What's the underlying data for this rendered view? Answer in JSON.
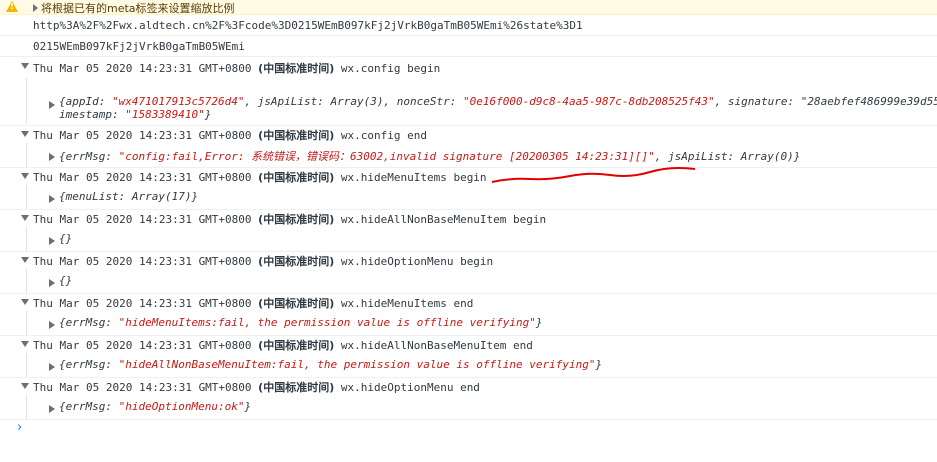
{
  "warning": {
    "text": "将根据已有的meta标签来设置缩放比例",
    "icon": "warning-triangle-icon"
  },
  "url_lines": [
    "http%3A%2F%2Fwx.aldtech.cn%2F%3Fcode%3D0215WEmB097kFj2jVrkB0gaTmB05WEmi%26state%3D1",
    "0215WEmB097kFj2jVrkB0gaTmB05WEmi"
  ],
  "log_groups": [
    {
      "date": "Thu Mar 05 2020 14:23:31 GMT+0800",
      "tz": "(中国标准时间)",
      "message": "wx.config begin",
      "body_line1": "{appId: \"wx471017913c5726d4\", jsApiList: Array(3), nonceStr: \"0e16f000-d9c8-4aa5-987c-8db208525f43\", signature: \"28aebfef486999e39d55",
      "body_line2": "imestamp: \"1583389410\"}"
    },
    {
      "date": "Thu Mar 05 2020 14:23:31 GMT+0800",
      "tz": "(中国标准时间)",
      "message": "wx.config end",
      "body_line1": "{errMsg: \"config:fail,Error: 系统错误，错误码：63002,invalid signature [20200305 14:23:31][]\", jsApiList: Array(0)}"
    },
    {
      "date": "Thu Mar 05 2020 14:23:31 GMT+0800",
      "tz": "(中国标准时间)",
      "message": "wx.hideMenuItems begin",
      "body_line1": "{menuList: Array(17)}"
    },
    {
      "date": "Thu Mar 05 2020 14:23:31 GMT+0800",
      "tz": "(中国标准时间)",
      "message": "wx.hideAllNonBaseMenuItem begin",
      "body_line1": "{}"
    },
    {
      "date": "Thu Mar 05 2020 14:23:31 GMT+0800",
      "tz": "(中国标准时间)",
      "message": "wx.hideOptionMenu begin",
      "body_line1": "{}"
    },
    {
      "date": "Thu Mar 05 2020 14:23:31 GMT+0800",
      "tz": "(中国标准时间)",
      "message": "wx.hideMenuItems end",
      "body_line1": "{errMsg: \"hideMenuItems:fail, the permission value is offline verifying\"}"
    },
    {
      "date": "Thu Mar 05 2020 14:23:31 GMT+0800",
      "tz": "(中国标准时间)",
      "message": "wx.hideAllNonBaseMenuItem end",
      "body_line1": "{errMsg: \"hideAllNonBaseMenuItem:fail, the permission value is offline verifying\"}"
    },
    {
      "date": "Thu Mar 05 2020 14:23:31 GMT+0800",
      "tz": "(中国标准时间)",
      "message": "wx.hideOptionMenu end",
      "body_line1": "{errMsg: \"hideOptionMenu:ok\"}"
    }
  ],
  "console_prompt": "›",
  "colors": {
    "warning_bg": "#fffbe5",
    "string_red": "#c41a16",
    "prompt_blue": "#1a73e8",
    "annotation_red": "#e00000"
  }
}
